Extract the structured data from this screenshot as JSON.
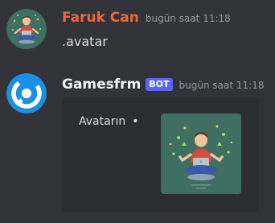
{
  "messages": [
    {
      "username": "Faruk Can",
      "username_color": "#f0683c",
      "timestamp": "bugün saat 11:18",
      "content": ".avatar",
      "avatar_icon": "person-meditating-laptop-avatar"
    },
    {
      "username": "Gamesfrm",
      "username_color": "#f2f3f5",
      "bot_tag": "BOT",
      "timestamp": "bugün saat 11:18",
      "avatar_icon": "gamesfrm-logo-avatar",
      "embed": {
        "description": "Avatarın",
        "separator": "•",
        "thumbnail_icon": "person-meditating-laptop-thumbnail"
      }
    }
  ],
  "colors": {
    "background": "#313338",
    "embed_background": "#2b2d31",
    "bot_tag": "#5865f2",
    "timestamp": "#949ba4",
    "avatar_green": "#3f6e62",
    "logo_blue": "#1a8fe3"
  }
}
